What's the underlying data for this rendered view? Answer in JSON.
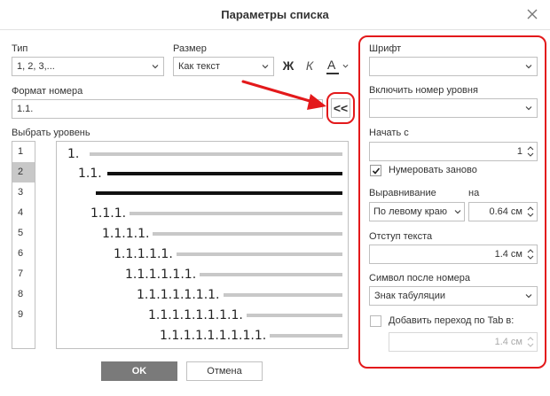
{
  "dialog": {
    "title": "Параметры списка"
  },
  "type": {
    "label": "Тип",
    "value": "1, 2, 3,..."
  },
  "size": {
    "label": "Размер",
    "value": "Как текст"
  },
  "format_buttons": {
    "bold": "Ж",
    "italic": "К",
    "color": "А"
  },
  "number_format": {
    "label": "Формат номера",
    "value": "1.1.",
    "insert_button": "<<"
  },
  "levels": {
    "label": "Выбрать уровень",
    "items": [
      "1",
      "2",
      "3",
      "4",
      "5",
      "6",
      "7",
      "8",
      "9"
    ],
    "selected": "2"
  },
  "preview": {
    "rows": [
      "1.",
      "1.1.",
      "",
      "1.1.1.",
      "1.1.1.1.",
      "1.1.1.1.1.",
      "1.1.1.1.1.1.",
      "1.1.1.1.1.1.1.",
      "1.1.1.1.1.1.1.1.",
      "1.1.1.1.1.1.1.1.1."
    ]
  },
  "right": {
    "font": {
      "label": "Шрифт",
      "value": ""
    },
    "include_level": {
      "label": "Включить номер уровня",
      "value": ""
    },
    "start_at": {
      "label": "Начать с",
      "value": "1"
    },
    "restart": {
      "label": "Нумеровать заново",
      "checked": true
    },
    "alignment": {
      "label": "Выравнивание",
      "value": "По левому краю"
    },
    "at": {
      "label": "на",
      "value": "0.64 см"
    },
    "indent": {
      "label": "Отступ текста",
      "value": "1.4 см"
    },
    "symbol_after": {
      "label": "Символ после номера",
      "value": "Знак табуляции"
    },
    "tab_stop": {
      "label": "Добавить переход по Tab в:",
      "checked": false,
      "value": "1.4 см"
    }
  },
  "footer": {
    "ok": "OK",
    "cancel": "Отмена"
  },
  "colors": {
    "annotation": "#e3191b",
    "primary_button": "#7a7a7a",
    "selected_level": "#c8c8c8"
  }
}
